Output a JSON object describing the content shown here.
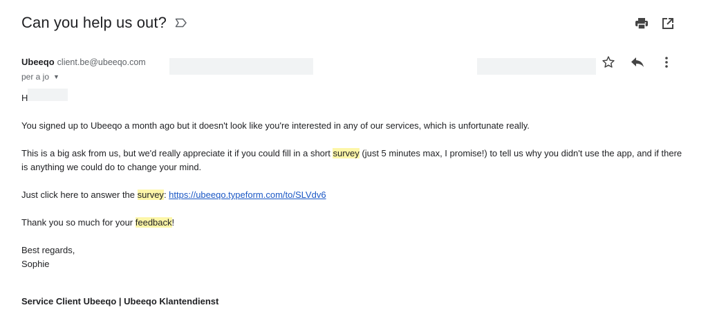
{
  "subject": "Can you help us out?",
  "sender": {
    "name": "Ubeeqo",
    "email": "client.be@ubeeqo.com"
  },
  "recipient": {
    "to_text": "per a jo"
  },
  "icons": {
    "label": "label-outline-icon",
    "print": "print-icon",
    "open_new": "open-in-new-window-icon",
    "star": "star-outline-icon",
    "reply": "reply-icon",
    "more": "more-vertical-icon"
  },
  "body": {
    "greeting": "Hi",
    "p1": "You signed up to Ubeeqo a month ago but it doesn't look like you're interested in any of our services, which is unfortunate really.",
    "p2_a": "This is a big ask from us, but we'd really appreciate it if you could fill in a short ",
    "p2_hl": "survey",
    "p2_b": " (just 5 minutes max, I promise!) to tell us why you didn't use the app, and if there is anything we could do to change your mind.",
    "p3_a": "Just click here to answer the ",
    "p3_hl": "survey",
    "p3_b": ": ",
    "p3_link": "https://ubeeqo.typeform.com/to/SLVdv6",
    "p4_a": "Thank you so much for your ",
    "p4_hl": "feedback",
    "p4_b": "!",
    "closing": "Best regards,",
    "signer": "Sophie",
    "signature": "Service Client Ubeeqo | Ubeeqo Klantendienst"
  },
  "colors": {
    "highlight": "#fdf6a8",
    "link": "#1a57c5"
  }
}
